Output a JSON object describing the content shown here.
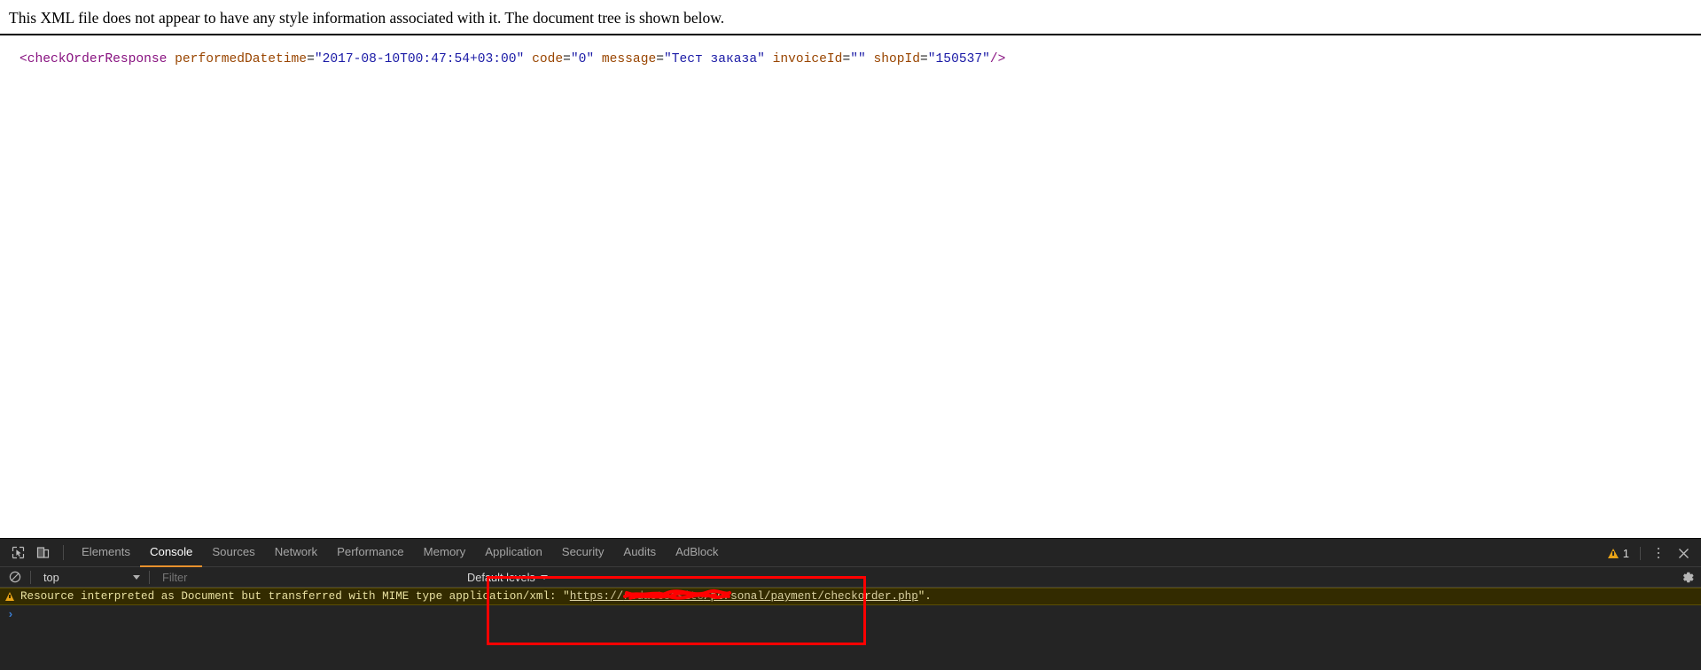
{
  "page": {
    "notice": "This XML file does not appear to have any style information associated with it. The document tree is shown below.",
    "xml": {
      "open_bracket": "<",
      "tag_name": "checkOrderResponse",
      "attributes": [
        {
          "name": "performedDatetime",
          "eq": "=",
          "value": "\"2017-08-10T00:47:54+03:00\""
        },
        {
          "name": "code",
          "eq": "=",
          "value": "\"0\""
        },
        {
          "name": "message",
          "eq": "=",
          "value": "\"Тест заказа\""
        },
        {
          "name": "invoiceId",
          "eq": "=",
          "value": "\"\""
        },
        {
          "name": "shopId",
          "eq": "=",
          "value": "\"150537\""
        }
      ],
      "close_bracket": "/>"
    }
  },
  "devtools": {
    "icons": {
      "inspect": "inspect-element-icon",
      "device": "device-toolbar-icon",
      "clear": "clear-console-icon",
      "gear": "gear-icon",
      "close": "close-icon",
      "more": "more-options-icon",
      "warning": "warning-icon"
    },
    "tabs": [
      {
        "label": "Elements",
        "active": false
      },
      {
        "label": "Console",
        "active": true
      },
      {
        "label": "Sources",
        "active": false
      },
      {
        "label": "Network",
        "active": false
      },
      {
        "label": "Performance",
        "active": false
      },
      {
        "label": "Memory",
        "active": false
      },
      {
        "label": "Application",
        "active": false
      },
      {
        "label": "Security",
        "active": false
      },
      {
        "label": "Audits",
        "active": false
      },
      {
        "label": "AdBlock",
        "active": false
      }
    ],
    "warning_count": "1",
    "filter_bar": {
      "context": "top",
      "filter_placeholder": "Filter",
      "filter_value": "",
      "levels": "Default levels"
    },
    "console": {
      "warning_message": "Resource interpreted as Document but transferred with MIME type application/xml:",
      "url_quote_open": "\"",
      "url_scheme": "https://",
      "url_host_redacted": "redactedsite",
      "url_path": "/personal/payment/checkorder.php",
      "url_quote_close": "\".",
      "prompt": "›"
    },
    "colors": {
      "panel_bg": "#242424",
      "warning_row_bg": "#332b00",
      "accent_tab": "#e8912d",
      "annotation": "#ff0000",
      "prompt_blue": "#3b7fd4"
    }
  }
}
